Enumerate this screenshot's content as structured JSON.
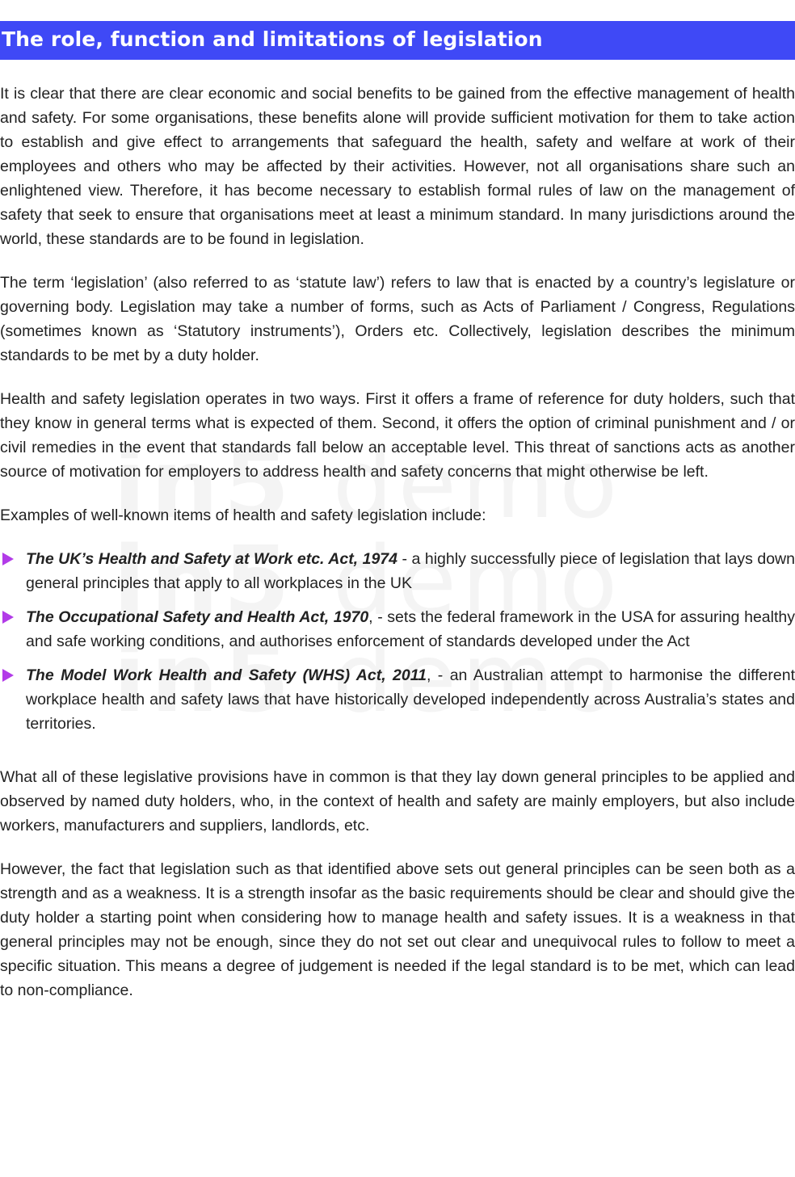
{
  "heading": "The role, function and limitations of legislation",
  "paragraphs_top": [
    "It is clear that there are clear economic and social benefits to be gained from the effective management of health and safety. For some organisations, these benefits alone will provide sufficient motivation for them to take action to establish and give effect to arrangements that safeguard the health, safety and welfare at work of their employees and others who may be affected by their activities. However, not all organisations share such an enlightened view. Therefore, it has become necessary to establish formal rules of law on the management of safety that seek to ensure that organisations meet at least a minimum standard. In many jurisdictions around the world, these standards are to be found in legislation.",
    "The term ‘legislation’ (also referred to as ‘statute law’) refers to law that is enacted by a country’s legislature or governing body. Legislation may take a number of forms, such as Acts of Parliament / Congress, Regulations (sometimes known as ‘Statutory instruments’), Orders etc. Collectively, legislation describes the minimum standards to be met by a duty holder.",
    "Health and safety legislation operates in two ways. First it offers a frame of reference for duty holders, such that they know in general terms what is expected of them. Second, it offers the option of criminal punishment and / or civil remedies in the event that standards fall below an acceptable level. This threat of sanctions acts as another source of motivation for employers to address health and safety concerns that might otherwise be left.",
    "Examples of well-known items of health and safety legislation include:"
  ],
  "examples": [
    {
      "act": "The UK’s Health and Safety at Work etc. Act, 1974",
      "text": " - a highly successfully piece of legislation that lays down general principles that apply to all workplaces in the UK"
    },
    {
      "act": "The Occupational Safety and Health Act, 1970",
      "text": ", - sets the federal framework in the USA for assuring healthy and safe working conditions, and authorises enforcement of standards developed under the Act"
    },
    {
      "act": "The Model Work Health and Safety (WHS) Act, 2011",
      "text": ", - an Australian attempt to harmonise the different workplace health and safety laws that have historically developed independently across Australia’s states and territories."
    }
  ],
  "paragraphs_bottom": [
    "What all of these legislative provisions have in common is that they lay down general principles to be applied and observed by named duty holders, who, in the context of health and safety are mainly employers, but also include workers, manufacturers and suppliers, landlords, etc.",
    "However, the fact that legislation such as that identified above sets out general principles can be seen both as a strength and as a weakness. It is a strength insofar as the basic requirements should be clear and should give the duty holder a starting point when considering how to manage health and safety issues. It is a weakness in that general principles may not be enough, since they do not set out clear and unequivocal rules to follow to meet a specific situation. This means a degree of judgement is needed if the legal standard is to be met, which can lead to non-compliance."
  ],
  "watermark": {
    "brand": "in5",
    "word": "demo"
  },
  "colors": {
    "heading_bar": "#3f49f6",
    "heading_text": "#ffffff",
    "bullet_arrow": "#b23be8",
    "body_text": "#222222"
  }
}
